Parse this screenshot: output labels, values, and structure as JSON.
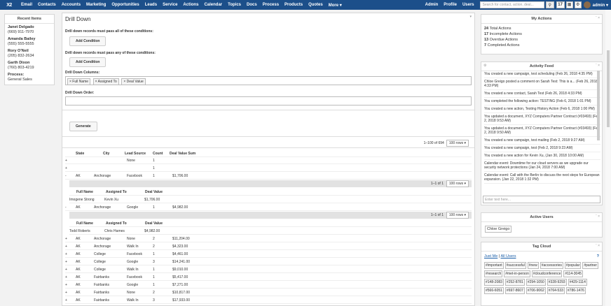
{
  "nav": {
    "logo": "X2",
    "items": [
      "Email",
      "Contacts",
      "Accounts",
      "Marketing",
      "Opportunities",
      "Leads",
      "Service",
      "Actions",
      "Calendar",
      "Topics",
      "Docs",
      "Process",
      "Products",
      "Quotes",
      "More ▾"
    ],
    "right": [
      "Admin",
      "Profile",
      "Users"
    ],
    "search_placeholder": "Search for contact, action, deal...",
    "notifications": "17",
    "user": "admin ▾"
  },
  "recent": {
    "title": "Recent Items",
    "items": [
      {
        "name": "Janet Delgado",
        "phone": "(669) 911-7970"
      },
      {
        "name": "Amanda Bailey",
        "phone": "(555) 555-5555"
      },
      {
        "name": "Rory O'Neil",
        "phone": "(205) 832-2634"
      },
      {
        "name": "Garth Dixon",
        "phone": "(760) 803-4219"
      },
      {
        "name": "Process:",
        "phone": "General Sales"
      }
    ]
  },
  "main": {
    "title": "Drill Down",
    "cond_all": "Drill down records must pass all of these conditions:",
    "cond_any": "Drill down records must pass any of these conditions:",
    "add_condition": "Add Condition",
    "columns_label": "Drill Down Columns:",
    "columns": [
      "× Full Name",
      "× Assigned To",
      "× Deal Value"
    ],
    "order_label": "Drill Down Order:",
    "generate": "Generate",
    "pager_text": "1–100 of 694",
    "rows_select": "100 rows ▾",
    "sub_pager": "1–1 of 1",
    "sub_rows": "100 rows ▾",
    "headers": [
      "State",
      "City",
      "Lead Source",
      "Count",
      "Deal Value Sum"
    ],
    "sub_headers": [
      "Full Name",
      "Assigned To",
      "Deal Value"
    ],
    "rows": [
      {
        "t": "+",
        "state": "",
        "city": "",
        "source": "None",
        "count": "1",
        "sum": ""
      },
      {
        "t": "+",
        "state": "",
        "city": "",
        "source": "",
        "count": "1",
        "sum": ""
      },
      {
        "t": "-",
        "state": "AK",
        "city": "Anchorage",
        "source": "Facebook",
        "count": "1",
        "sum": "$1,706.00"
      },
      {
        "t": "-",
        "state": "AK",
        "city": "Anchorage",
        "source": "Google",
        "count": "1",
        "sum": "$4,982.00"
      },
      {
        "t": "+",
        "state": "AK",
        "city": "Anchorage",
        "source": "None",
        "count": "2",
        "sum": "$11,204.00"
      },
      {
        "t": "+",
        "state": "AK",
        "city": "Anchorage",
        "source": "Walk In",
        "count": "2",
        "sum": "$4,323.00"
      },
      {
        "t": "+",
        "state": "AK",
        "city": "College",
        "source": "Facebook",
        "count": "1",
        "sum": "$4,461.00"
      },
      {
        "t": "+",
        "state": "AK",
        "city": "College",
        "source": "Google",
        "count": "3",
        "sum": "$14,241.00"
      },
      {
        "t": "+",
        "state": "AK",
        "city": "College",
        "source": "Walk In",
        "count": "1",
        "sum": "$9,010.00"
      },
      {
        "t": "+",
        "state": "AK",
        "city": "Fairbanks",
        "source": "Facebook",
        "count": "1",
        "sum": "$5,417.00"
      },
      {
        "t": "+",
        "state": "AK",
        "city": "Fairbanks",
        "source": "Google",
        "count": "1",
        "sum": "$7,271.00"
      },
      {
        "t": "+",
        "state": "AK",
        "city": "Fairbanks",
        "source": "None",
        "count": "2",
        "sum": "$10,817.00"
      },
      {
        "t": "+",
        "state": "AK",
        "city": "Fairbanks",
        "source": "Walk In",
        "count": "3",
        "sum": "$17,933.00"
      }
    ],
    "sub1": {
      "name": "Imogene Strong",
      "assigned": "Kevin Xu",
      "value": "$1,706.00"
    },
    "sub2": {
      "name": "Todd Roberts",
      "assigned": "Chris Hames",
      "value": "$4,982.00"
    }
  },
  "actions": {
    "title": "My Actions",
    "items": [
      {
        "n": "24",
        "l": "Total Actions"
      },
      {
        "n": "17",
        "l": "Incomplete Actions"
      },
      {
        "n": "13",
        "l": "Overdue Actions"
      },
      {
        "n": "7",
        "l": "Completed Actions"
      }
    ]
  },
  "feed": {
    "title": "Activity Feed",
    "placeholder": "Enter text here...",
    "items": [
      "You created a new campaign, test scheduling (Feb 26, 2018 4:35 PM)",
      "Chloe Greigo posted a comment on Sarah Test: This is a... (Feb 26, 2018 4:33 PM)",
      "You created a new contact, Sarah Test (Feb 26, 2018 4:33 PM)",
      "You completed the following action: TESTING (Feb 6, 2018 1:01 PM)",
      "You created a new action, Testing History Action (Feb 6, 2018 1:00 PM)",
      "You updated a document, XYZ Computers Partner Contract (#03493) (Feb 2, 2018 9:53 AM)",
      "You updated a document, XYZ Computers Partner Contract (#03493) (Feb 2, 2018 9:50 AM)",
      "You created a new campaign, test mailing (Feb 2, 2018 9:27 AM)",
      "You created a new campaign, test (Feb 2, 2018 9:23 AM)",
      "You created a new action for Kevin Xu, (Jan 30, 2018 10:00 AM)",
      "Calendar event: Downtime for our cloud servers as we upgrade our security network protections (Jan 24, 2018 7:00 AM)",
      "Calendar event: Call with the Berlin to discuss the next steps for European expansion. (Jan 22, 2018 1:32 PM)"
    ]
  },
  "users": {
    "title": "Active Users",
    "items": [
      "Chloe Greigo"
    ]
  },
  "tags": {
    "title": "Tag Cloud",
    "just_me": "Just Me",
    "all_users": "All Users",
    "items": [
      "#important",
      "#successful",
      "#new",
      "#accessories",
      "#popular",
      "#partner",
      "#research",
      "#met-in-person",
      "#cloudconference",
      "#114-3045",
      "#148-2083",
      "#252-8781",
      "#294-1050",
      "#328-9293",
      "#429-1114",
      "#566-6051",
      "#697-8607",
      "#706-9062",
      "#764-533",
      "#786-1476"
    ]
  }
}
